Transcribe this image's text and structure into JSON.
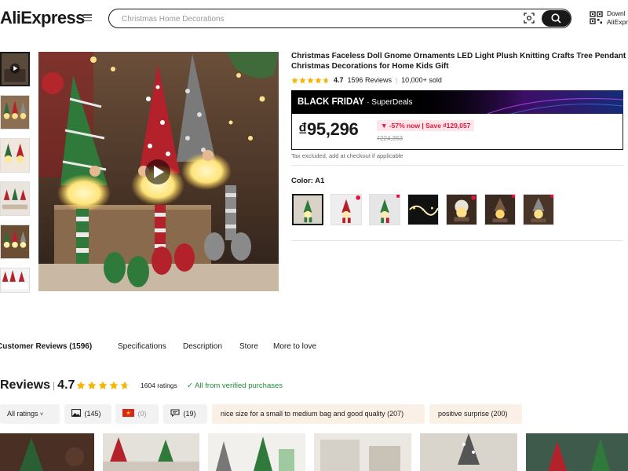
{
  "header": {
    "logo": "AliExpress",
    "search_placeholder": "Christmas Home Decorations",
    "download_line1": "Downl",
    "download_line2": "AliExpr"
  },
  "product": {
    "title": "Christmas Faceless Doll Gnome Ornaments LED Light Plush Knitting Crafts Tree Pendant Christmas Decorations for Home Kids Gift",
    "rating": "4.7",
    "reviews": "1596 Reviews",
    "sold": "10,000+ sold",
    "promo_main": "BLACK FRIDAY",
    "promo_sub": "SuperDeals",
    "price": "₫95,296",
    "discount": "-57% now | Save ₫129,057",
    "old_price": "₫224,353",
    "tax_note": "Tax excluded, add at checkout if applicable",
    "color_label": "Color: A1"
  },
  "tabs": [
    {
      "label": "Customer Reviews (1596)"
    },
    {
      "label": "Specifications"
    },
    {
      "label": "Description"
    },
    {
      "label": "Store"
    },
    {
      "label": "More to love"
    }
  ],
  "reviews": {
    "title": "Reviews",
    "rating": "4.7",
    "ratings_count": "1604 ratings",
    "verified": "All from verified purchases",
    "filters": {
      "all": "All ratings",
      "images": "(145)",
      "country": "(0)",
      "comments": "(19)",
      "tag1": "nice size for a small to medium bag and good quality (207)",
      "tag2": "positive surprise (200)"
    }
  },
  "colors": {
    "accent": "#e8113a",
    "star": "#f7b500",
    "verified": "#1f8a3b",
    "promo_bg": "#000000"
  }
}
